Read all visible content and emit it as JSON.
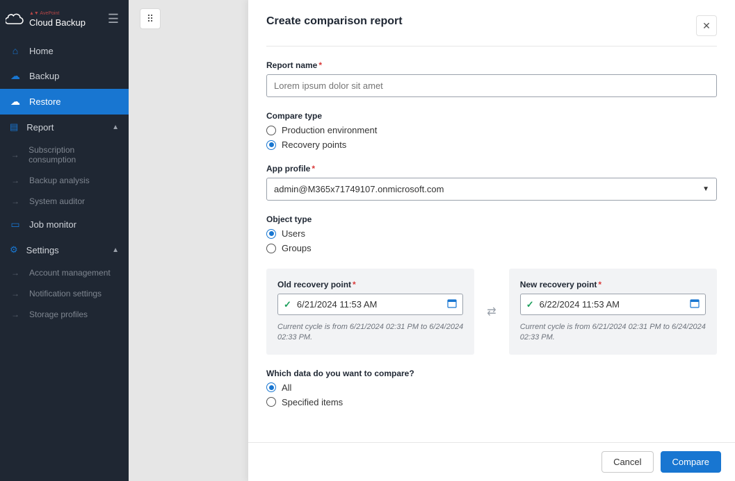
{
  "brand": {
    "small": "▲▼ AvePoint",
    "title": "Cloud Backup"
  },
  "sidebar": {
    "items": [
      {
        "label": "Home"
      },
      {
        "label": "Backup"
      },
      {
        "label": "Restore"
      },
      {
        "label": "Report"
      }
    ],
    "report_sub": [
      {
        "label": "Subscription consumption"
      },
      {
        "label": "Backup analysis"
      },
      {
        "label": "System auditor"
      }
    ],
    "job_monitor": "Job monitor",
    "settings": "Settings",
    "settings_sub": [
      {
        "label": "Account management"
      },
      {
        "label": "Notification settings"
      },
      {
        "label": "Storage profiles"
      }
    ]
  },
  "panel": {
    "title": "Create comparison report",
    "report_name_label": "Report name",
    "report_name_placeholder": "Lorem ipsum dolor sit amet",
    "compare_type_label": "Compare type",
    "compare_type_options": {
      "production": "Production environment",
      "recovery": "Recovery points"
    },
    "app_profile_label": "App profile",
    "app_profile_value": "admin@M365x71749107.onmicrosoft.com",
    "object_type_label": "Object type",
    "object_type_options": {
      "users": "Users",
      "groups": "Groups"
    },
    "old_rp_label": "Old recovery point",
    "old_rp_value": "6/21/2024 11:53 AM",
    "old_rp_hint": "Current cycle is from 6/21/2024 02:31 PM to 6/24/2024 02:33 PM.",
    "new_rp_label": "New recovery point",
    "new_rp_value": "6/22/2024 11:53 AM",
    "new_rp_hint": "Current cycle is from 6/21/2024 02:31 PM to 6/24/2024 02:33 PM.",
    "which_data_label": "Which data do you want to compare?",
    "which_data_options": {
      "all": "All",
      "specified": "Specified items"
    },
    "footer": {
      "cancel": "Cancel",
      "compare": "Compare"
    }
  }
}
